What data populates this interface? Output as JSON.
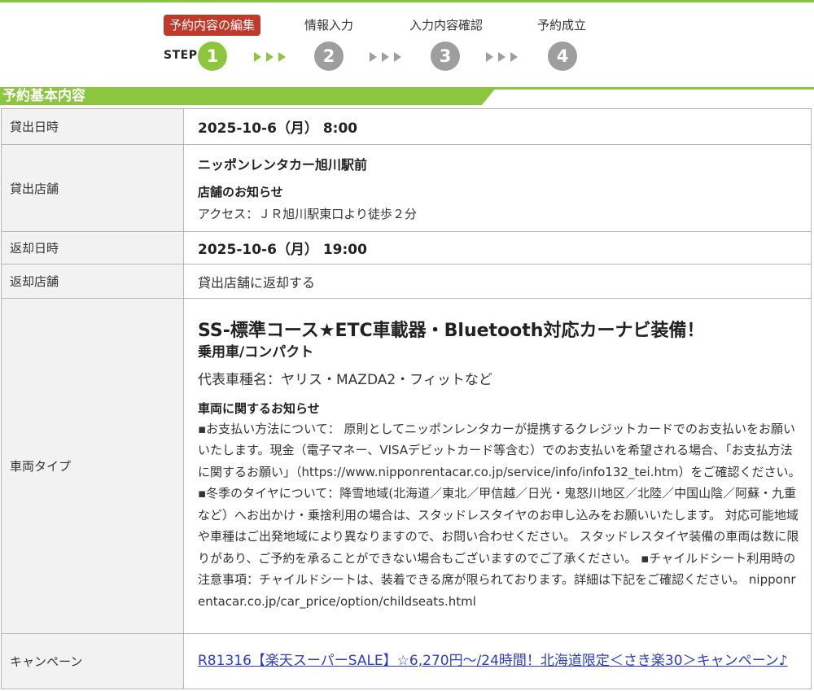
{
  "steps": {
    "step_word": "STEP",
    "items": [
      {
        "label": "予約内容の編集",
        "number": "1",
        "active": true
      },
      {
        "label": "情報入力",
        "number": "2",
        "active": false
      },
      {
        "label": "入力内容確認",
        "number": "3",
        "active": false
      },
      {
        "label": "予約成立",
        "number": "4",
        "active": false
      }
    ]
  },
  "section": {
    "title": "予約基本内容"
  },
  "rows": {
    "pickup_datetime": {
      "label": "貸出日時",
      "value": "2025-10-6（月） 8:00"
    },
    "pickup_store": {
      "label": "貸出店舗",
      "name": "ニッポンレンタカー旭川駅前",
      "notice_heading": "店舗のお知らせ",
      "notice_text": "アクセス：ＪＲ旭川駅東口より徒歩２分"
    },
    "return_datetime": {
      "label": "返却日時",
      "value": "2025-10-6（月） 19:00"
    },
    "return_store": {
      "label": "返却店舗",
      "value": "貸出店舗に返却する"
    },
    "vehicle_type": {
      "label": "車両タイプ",
      "title": "SS-標準コース★ETC車載器・Bluetooth対応カーナビ装備！",
      "class": "乗用車/コンパクト",
      "models": "代表車種名：ヤリス・MAZDA2・フィットなど",
      "notice_heading": "車両に関するお知らせ",
      "notice_text": "▪お支払い方法について： 原則としてニッポンレンタカーが提携するクレジットカードでのお支払いをお願いいたします。現金（電子マネー、VISAデビットカード等含む）でのお支払いを希望される場合、「お支払方法に関するお願い」（https://www.nipponrentacar.co.jp/service/info/info132_tei.htm）をご確認ください。　 ▪冬季のタイヤについて：降雪地域(北海道／東北／甲信越／日光・鬼怒川地区／北陸／中国山陰／阿蘇・九重など）へお出かけ・乗捨利用の場合は、スタッドレスタイヤのお申し込みをお願いいたします。 対応可能地域や車種はご出発地域により異なりますので、お問い合わせください。 スタッドレスタイヤ装備の車両は数に限りがあり、ご予約を承ることができない場合もございますのでご了承ください。 ▪チャイルドシート利用時の注意事項：チャイルドシートは、装着できる席が限られております。詳細は下記をご確認ください。 nipponrentacar.co.jp/car_price/option/childseats.html"
    },
    "campaign": {
      "label": "キャンペーン",
      "link_text": "R81316【楽天スーパーSALE】☆6,270円～/24時間！北海道限定＜さき楽30＞キャンペーン♪"
    }
  },
  "colors": {
    "accent_green": "#8cc63f",
    "active_red": "#c0392b",
    "inactive_gray": "#9e9e9e",
    "link_blue": "#2a3cc7"
  }
}
